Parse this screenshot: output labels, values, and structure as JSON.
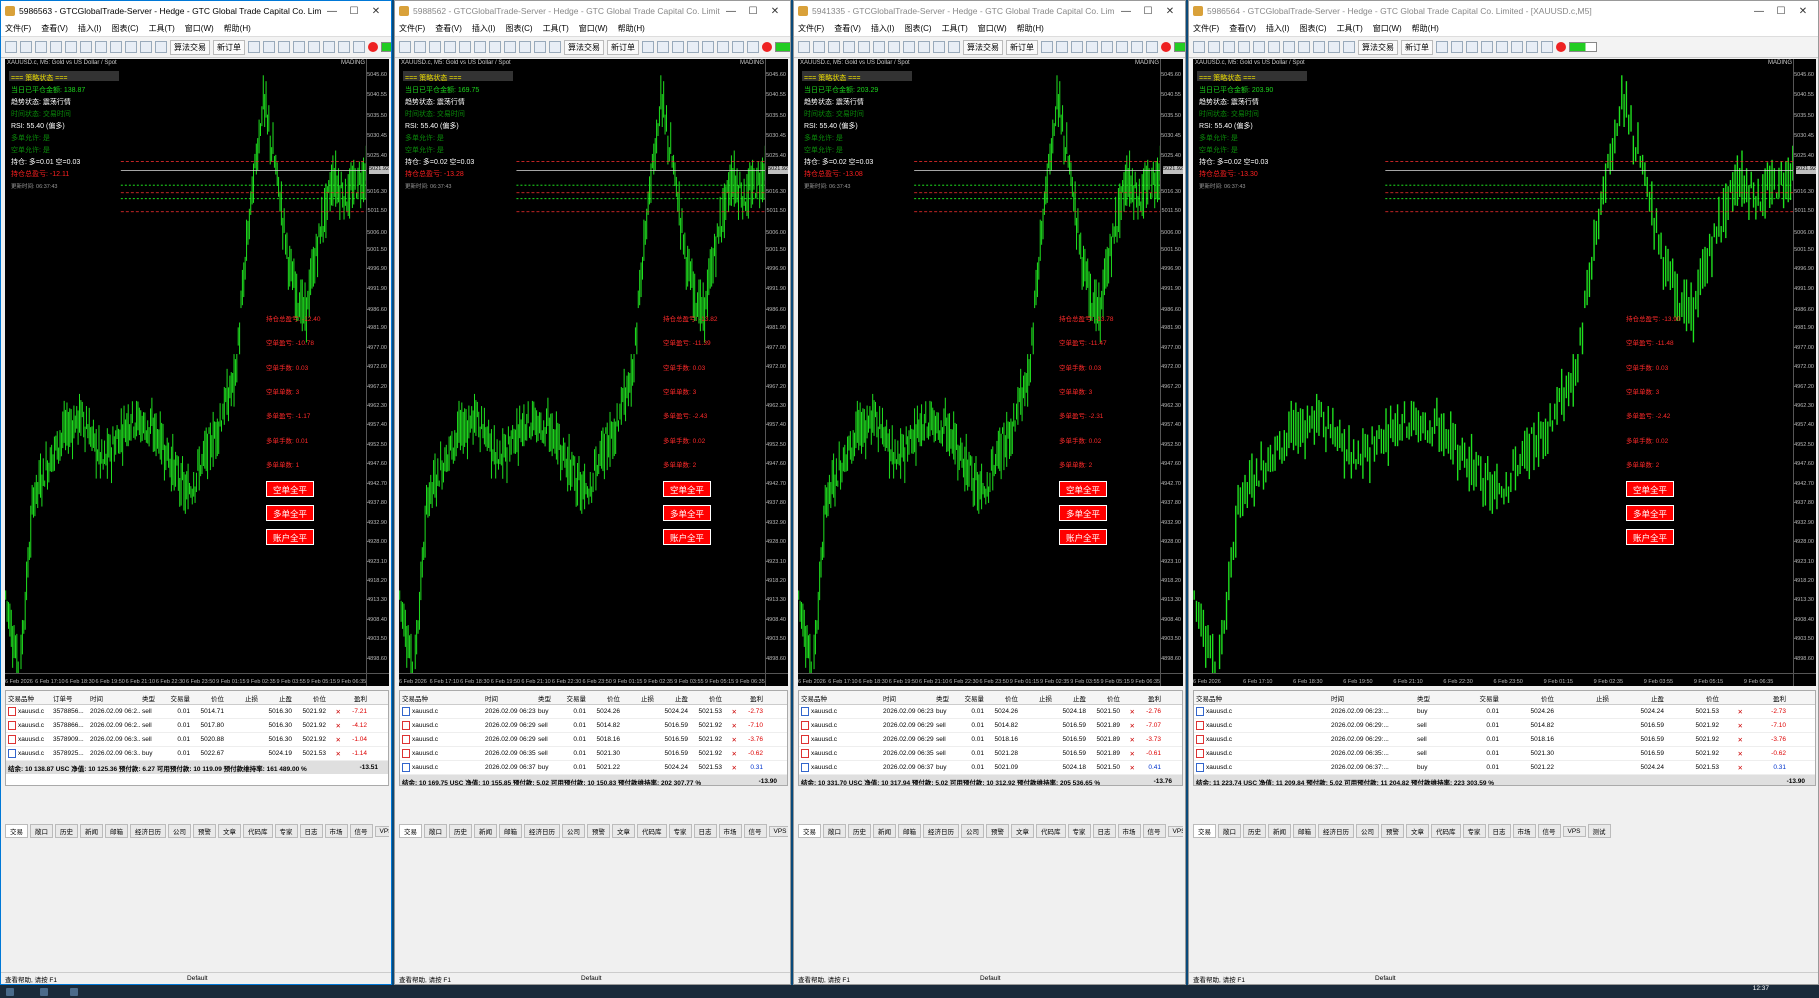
{
  "windows": [
    {
      "title": "5986563 - GTCGlobalTrade-Server - Hedge - GTC Global Trade Capital Co. Limited - [XAUUSD.c,M5]",
      "active": true,
      "chart_title": "XAUUSD.c, M5:  Gold vs US Dollar / Spot",
      "status": {
        "header": "=== 策略状态 ===",
        "today_pnl": "当日已平仓金额: 138.87",
        "trend": "趋势状态: 震荡行情",
        "time_state": "时间状态: 交易时间",
        "rsi": "RSI: 55.40 (偏多)",
        "long_allowed": "多单允许: 是",
        "short_allowed": "空单允许: 是",
        "position": "持仓: 多=0.01 空=0.03",
        "float_pnl": "持仓总盈亏: -12.11",
        "update_time": "更新时间: 06:37:43"
      },
      "right_info": [
        "持仓总盈亏: -12.40",
        "空单盈亏: -10.78",
        "空单手数: 0.03",
        "空单单数: 3",
        "多单盈亏: -1.17",
        "多单手数: 0.01",
        "多单单数: 1"
      ],
      "buttons": [
        "空单全平",
        "多单全平",
        "账户全平"
      ],
      "columns": [
        "交易品种",
        "订单号",
        "时间",
        "类型",
        "交易量",
        "价位",
        "止损",
        "止盈",
        "价位",
        "",
        "盈利"
      ],
      "rows": [
        [
          "xauusd.c",
          "3578856...",
          "2026.02.09 06:2...",
          "sell",
          "0.01",
          "5014.71",
          "",
          "5016.30",
          "5021.92",
          "-7.21"
        ],
        [
          "xauusd.c",
          "3578866...",
          "2026.02.09 06:2...",
          "sell",
          "0.01",
          "5017.80",
          "",
          "5016.30",
          "5021.92",
          "-4.12"
        ],
        [
          "xauusd.c",
          "3578909...",
          "2026.02.09 06:3...",
          "sell",
          "0.01",
          "5020.88",
          "",
          "5016.30",
          "5021.92",
          "-1.04"
        ],
        [
          "xauusd.c",
          "3578925...",
          "2026.02.09 06:3...",
          "buy",
          "0.01",
          "5022.67",
          "",
          "5024.19",
          "5021.53",
          "-1.14"
        ]
      ],
      "summary": "结余: 10 138.87 USC  净值: 10 125.36  预付款: 6.27  可用预付款: 10 119.09  预付款维持率: 161 489.00 %",
      "summary_total": "-13.51"
    },
    {
      "title": "5988562 - GTCGlobalTrade-Server - Hedge - GTC Global Trade Capital Co. Limited - [XAUUSD.c,M5]",
      "active": false,
      "chart_title": "XAUUSD.c, M5:  Gold vs US Dollar / Spot",
      "status": {
        "header": "=== 策略状态 ===",
        "today_pnl": "当日已平仓金额: 169.75",
        "trend": "趋势状态: 震荡行情",
        "time_state": "时间状态: 交易时间",
        "rsi": "RSI: 55.40 (偏多)",
        "long_allowed": "多单允许: 是",
        "short_allowed": "空单允许: 是",
        "position": "持仓: 多=0.02 空=0.03",
        "float_pnl": "持仓总盈亏: -13.28",
        "update_time": "更新时间: 06:37:43"
      },
      "right_info": [
        "持仓总盈亏: -13.82",
        "空单盈亏: -11.39",
        "空单手数: 0.03",
        "空单单数: 3",
        "多单盈亏: -2.43",
        "多单手数: 0.02",
        "多单单数: 2"
      ],
      "buttons": [
        "空单全平",
        "多单全平",
        "账户全平"
      ],
      "columns": [
        "交易品种",
        "",
        "时间",
        "类型",
        "交易量",
        "价位",
        "止损",
        "止盈",
        "价位",
        "",
        "盈利"
      ],
      "rows": [
        [
          "xauusd.c",
          "",
          "2026.02.09 06:23:...",
          "buy",
          "0.01",
          "5024.26",
          "",
          "5024.24",
          "5021.53",
          "-2.73"
        ],
        [
          "xauusd.c",
          "",
          "2026.02.09 06:29:...",
          "sell",
          "0.01",
          "5014.82",
          "",
          "5016.59",
          "5021.92",
          "-7.10"
        ],
        [
          "xauusd.c",
          "",
          "2026.02.09 06:29:...",
          "sell",
          "0.01",
          "5018.16",
          "",
          "5016.59",
          "5021.92",
          "-3.76"
        ],
        [
          "xauusd.c",
          "",
          "2026.02.09 06:35:...",
          "sell",
          "0.01",
          "5021.30",
          "",
          "5016.59",
          "5021.92",
          "-0.62"
        ],
        [
          "xauusd.c",
          "",
          "2026.02.09 06:37:...",
          "buy",
          "0.01",
          "5021.22",
          "",
          "5024.24",
          "5021.53",
          "0.31"
        ]
      ],
      "summary": "结余: 10 169.75 USC  净值: 10 155.85  预付款: 5.02  可用预付款: 10 150.83  预付款维持率: 202 307.77 %",
      "summary_total": "-13.90"
    },
    {
      "title": "5941335 - GTCGlobalTrade-Server - Hedge - GTC Global Trade Capital Co. Limited - [XAUUSD.c,M5]",
      "active": false,
      "chart_title": "XAUUSD.c, M5:  Gold vs US Dollar / Spot",
      "status": {
        "header": "=== 策略状态 ===",
        "today_pnl": "当日已平仓金额: 203.29",
        "trend": "趋势状态: 震荡行情",
        "time_state": "时间状态: 交易时间",
        "rsi": "RSI: 55.40 (偏多)",
        "long_allowed": "多单允许: 是",
        "short_allowed": "空单允许: 是",
        "position": "持仓: 多=0.02 空=0.03",
        "float_pnl": "持仓总盈亏: -13.08",
        "update_time": "更新时间: 06:37:43"
      },
      "right_info": [
        "持仓总盈亏: -13.78",
        "空单盈亏: -11.47",
        "空单手数: 0.03",
        "空单单数: 3",
        "多单盈亏: -2.31",
        "多单手数: 0.02",
        "多单单数: 2"
      ],
      "buttons": [
        "空单全平",
        "多单全平",
        "账户全平"
      ],
      "columns": [
        "交易品种",
        "",
        "时间",
        "类型",
        "交易量",
        "价位",
        "止损",
        "止盈",
        "价位",
        "",
        "盈利"
      ],
      "rows": [
        [
          "xauusd.c",
          "",
          "2026.02.09 06:23:...",
          "buy",
          "0.01",
          "5024.26",
          "",
          "5024.18",
          "5021.50",
          "-2.76"
        ],
        [
          "xauusd.c",
          "",
          "2026.02.09 06:29:...",
          "sell",
          "0.01",
          "5014.82",
          "",
          "5016.59",
          "5021.89",
          "-7.07"
        ],
        [
          "xauusd.c",
          "",
          "2026.02.09 06:29:...",
          "sell",
          "0.01",
          "5018.16",
          "",
          "5016.59",
          "5021.89",
          "-3.73"
        ],
        [
          "xauusd.c",
          "",
          "2026.02.09 06:35:...",
          "sell",
          "0.01",
          "5021.28",
          "",
          "5016.59",
          "5021.89",
          "-0.61"
        ],
        [
          "xauusd.c",
          "",
          "2026.02.09 06:37:...",
          "buy",
          "0.01",
          "5021.09",
          "",
          "5024.18",
          "5021.50",
          "0.41"
        ]
      ],
      "summary": "结余: 10 331.70 USC  净值: 10 317.94  预付款: 5.02  可用预付款: 10 312.92  预付款维持率: 205 536.65 %",
      "summary_total": "-13.76"
    },
    {
      "title": "5986564 - GTCGlobalTrade-Server - Hedge - GTC Global Trade Capital Co. Limited - [XAUUSD.c,M5]",
      "active": false,
      "chart_title": "XAUUSD.c, M5:  Gold vs US Dollar / Spot",
      "status": {
        "header": "=== 策略状态 ===",
        "today_pnl": "当日已平仓金额: 203.90",
        "trend": "趋势状态: 震荡行情",
        "time_state": "时间状态: 交易时间",
        "rsi": "RSI: 55.40 (偏多)",
        "long_allowed": "多单允许: 是",
        "short_allowed": "空单允许: 是",
        "position": "持仓: 多=0.02 空=0.03",
        "float_pnl": "持仓总盈亏: -13.30",
        "update_time": "更新时间: 06:37:43"
      },
      "right_info": [
        "持仓总盈亏: -13.90",
        "空单盈亏: -11.48",
        "空单手数: 0.03",
        "空单单数: 3",
        "多单盈亏: -2.42",
        "多单手数: 0.02",
        "多单单数: 2"
      ],
      "buttons": [
        "空单全平",
        "多单全平",
        "账户全平"
      ],
      "columns": [
        "交易品种",
        "",
        "时间",
        "类型",
        "交易量",
        "价位",
        "止损",
        "止盈",
        "价位",
        "",
        "盈利"
      ],
      "rows": [
        [
          "xauusd.c",
          "",
          "2026.02.09 06:23:...",
          "buy",
          "0.01",
          "5024.26",
          "",
          "5024.24",
          "5021.53",
          "-2.73"
        ],
        [
          "xauusd.c",
          "",
          "2026.02.09 06:29:...",
          "sell",
          "0.01",
          "5014.82",
          "",
          "5016.59",
          "5021.92",
          "-7.10"
        ],
        [
          "xauusd.c",
          "",
          "2026.02.09 06:29:...",
          "sell",
          "0.01",
          "5018.16",
          "",
          "5016.59",
          "5021.92",
          "-3.76"
        ],
        [
          "xauusd.c",
          "",
          "2026.02.09 06:35:...",
          "sell",
          "0.01",
          "5021.30",
          "",
          "5016.59",
          "5021.92",
          "-0.62"
        ],
        [
          "xauusd.c",
          "",
          "2026.02.09 06:37:...",
          "buy",
          "0.01",
          "5021.22",
          "",
          "5024.24",
          "5021.53",
          "0.31"
        ]
      ],
      "summary": "结余: 11 223.74 USC  净值: 11 209.84  预付款: 5.02  可用预付款: 11 204.82  预付款维持率: 223 303.59 %",
      "summary_total": "-13.90"
    }
  ],
  "menu": [
    "文件(F)",
    "查看(V)",
    "插入(I)",
    "图表(C)",
    "工具(T)",
    "窗口(W)",
    "帮助(H)"
  ],
  "toolbar": {
    "algo": "算法交易",
    "new_order": "新订单"
  },
  "tabs": [
    "交易",
    "敞口",
    "历史",
    "新闻",
    "邮箱",
    "经济日历",
    "公司",
    "预警",
    "文章",
    "代码库",
    "专家",
    "日志",
    "市场",
    "信号",
    "VPS",
    "测试"
  ],
  "statusbar": {
    "help": "查看帮助, 请按 F1",
    "profile": "Default"
  },
  "chart_badge": "MADING",
  "y_ticks": [
    "5045.60",
    "5040.55",
    "5035.50",
    "5030.45",
    "5025.40",
    "5021.92",
    "5016.30",
    "5011.50",
    "5006.00",
    "5001.50",
    "4996.90",
    "4991.90",
    "4986.60",
    "4981.90",
    "4977.00",
    "4972.00",
    "4967.20",
    "4962.30",
    "4957.40",
    "4952.50",
    "4947.60",
    "4942.70",
    "4937.80",
    "4932.90",
    "4928.00",
    "4923.10",
    "4918.20",
    "4913.30",
    "4908.40",
    "4903.50",
    "4898.60"
  ],
  "x_ticks": [
    "6 Feb 2026",
    "6 Feb 17:10",
    "6 Feb 18:30",
    "6 Feb 19:50",
    "6 Feb 21:10",
    "6 Feb 22:30",
    "6 Feb 23:50",
    "9 Feb 01:15",
    "9 Feb 02:35",
    "9 Feb 03:55",
    "9 Feb 05:15",
    "9 Feb 06:35"
  ],
  "clock": "12:37"
}
